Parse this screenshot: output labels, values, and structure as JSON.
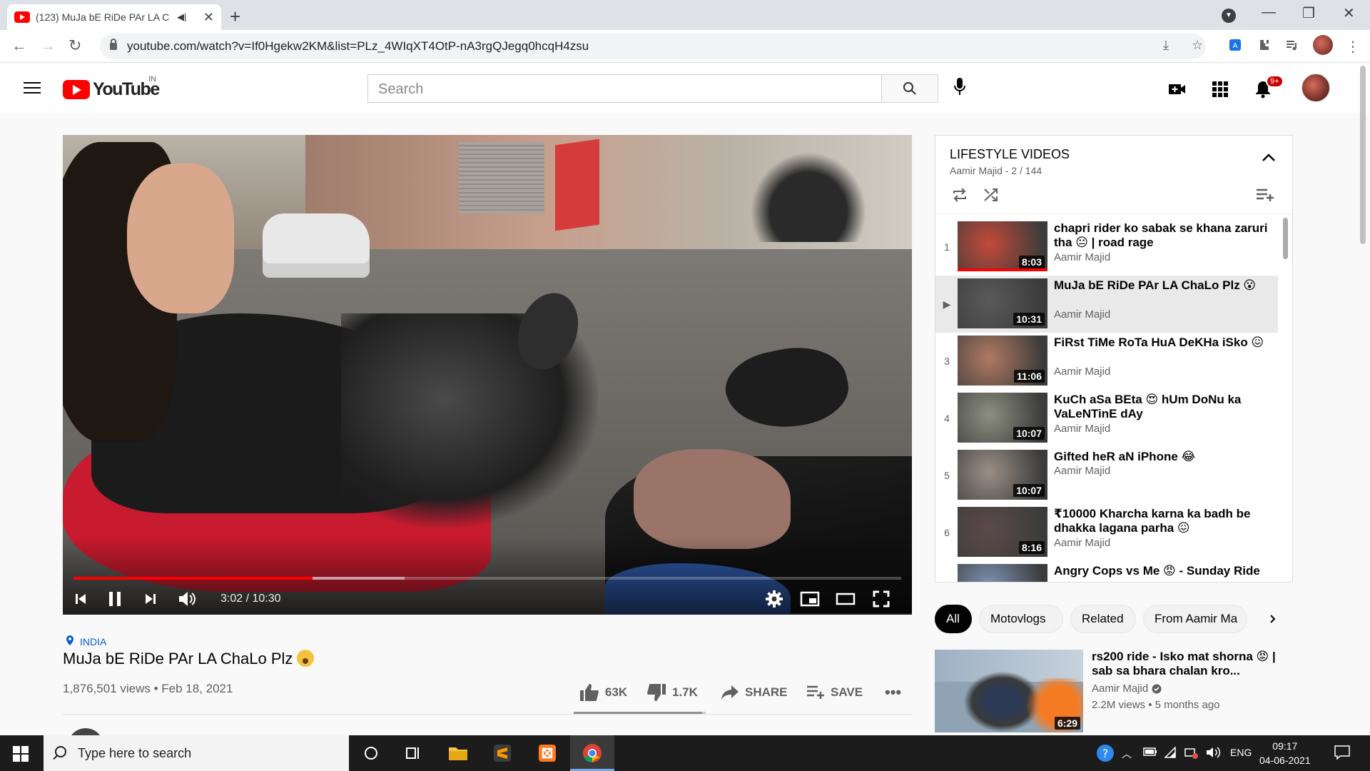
{
  "browser": {
    "tab_title": "(123) MuJa bE RiDe PAr LA C",
    "url": "youtube.com/watch?v=If0Hgekw2KM&list=PLz_4WIqXT4OtP-nA3rgQJegq0hcqH4zsu"
  },
  "masthead": {
    "logo_text": "YouTube",
    "region": "IN",
    "search_placeholder": "Search",
    "notification_count": "9+"
  },
  "player": {
    "time": "3:02 / 10:30",
    "played_fraction": 0.289,
    "buffered_fraction": 0.4
  },
  "video": {
    "location": "INDIA",
    "title": "MuJa bE RiDe PAr LA ChaLo Plz",
    "views_date": "1,876,501 views • Feb 18, 2021",
    "likes": "63K",
    "dislikes": "1.7K",
    "share_label": "SHARE",
    "save_label": "SAVE",
    "like_ratio": 0.974
  },
  "playlist": {
    "title": "LIFESTYLE VIDEOS",
    "subtitle": "Aamir Majid - 2 / 144",
    "items": [
      {
        "index": "1",
        "title": "chapri rider ko sabak se khana zaruri tha 😐 | road rage",
        "channel": "Aamir Majid",
        "duration": "8:03",
        "watched": true,
        "thumb": "#c44a3a"
      },
      {
        "index": "▶",
        "title": "MuJa bE RiDe PAr LA ChaLo Plz 😮",
        "channel": "Aamir Majid",
        "duration": "10:31",
        "watched": false,
        "thumb": "#5a5a5a"
      },
      {
        "index": "3",
        "title": "FiRst TiMe RoTa HuA DeKHa iSko 😖",
        "channel": "Aamir Majid",
        "duration": "11:06",
        "watched": false,
        "thumb": "#b07a62"
      },
      {
        "index": "4",
        "title": "KuCh aSa BEta 😍 hUm DoNu ka VaLeNTinE dAy",
        "channel": "Aamir Majid",
        "duration": "10:07",
        "watched": false,
        "thumb": "#8d8f80"
      },
      {
        "index": "5",
        "title": "Gifted heR aN iPhone 😂",
        "channel": "Aamir Majid",
        "duration": "10:07",
        "watched": false,
        "thumb": "#9a8f86"
      },
      {
        "index": "6",
        "title": "₹10000 Kharcha karna ka badh be dhakka lagana parha 😖",
        "channel": "Aamir Majid",
        "duration": "8:16",
        "watched": false,
        "thumb": "#5c4a4a"
      },
      {
        "index": "",
        "title": "Angry Cops vs Me 😡 - Sunday Ride",
        "channel": "",
        "duration": "",
        "watched": false,
        "thumb": "#7d94b4"
      }
    ]
  },
  "chips": [
    "All",
    "Motovlogs",
    "Related",
    "From Aamir Ma"
  ],
  "related": {
    "title": "rs200 ride - Isko mat shorna 😡 | sab sa bhara chalan kro...",
    "channel": "Aamir Majid",
    "views_age": "2.2M views • 5 months ago",
    "duration": "6:29"
  },
  "taskbar": {
    "search_placeholder": "Type here to search",
    "language": "ENG",
    "time": "09:17",
    "date": "04-06-2021"
  }
}
